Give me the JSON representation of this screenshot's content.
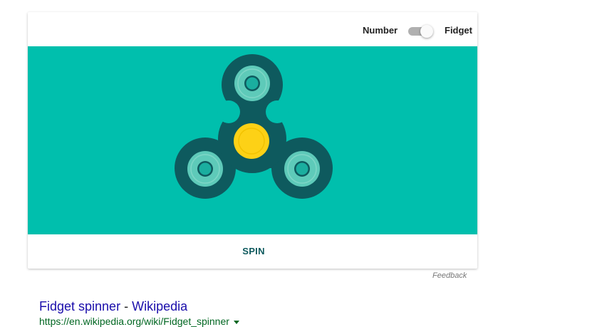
{
  "header": {
    "mode_left_label": "Number",
    "mode_right_label": "Fidget",
    "toggle_state": "fidget"
  },
  "spinner": {
    "stage_color": "#00bfad",
    "body_color": "#0e5a5e",
    "bearing_color": "#5ecab9",
    "center_color": "#fdd116"
  },
  "actions": {
    "spin_label": "SPIN",
    "feedback_label": "Feedback"
  },
  "result": {
    "title": "Fidget spinner",
    "separator": " - ",
    "source": "Wikipedia",
    "url": "https://en.wikipedia.org/wiki/Fidget_spinner"
  }
}
